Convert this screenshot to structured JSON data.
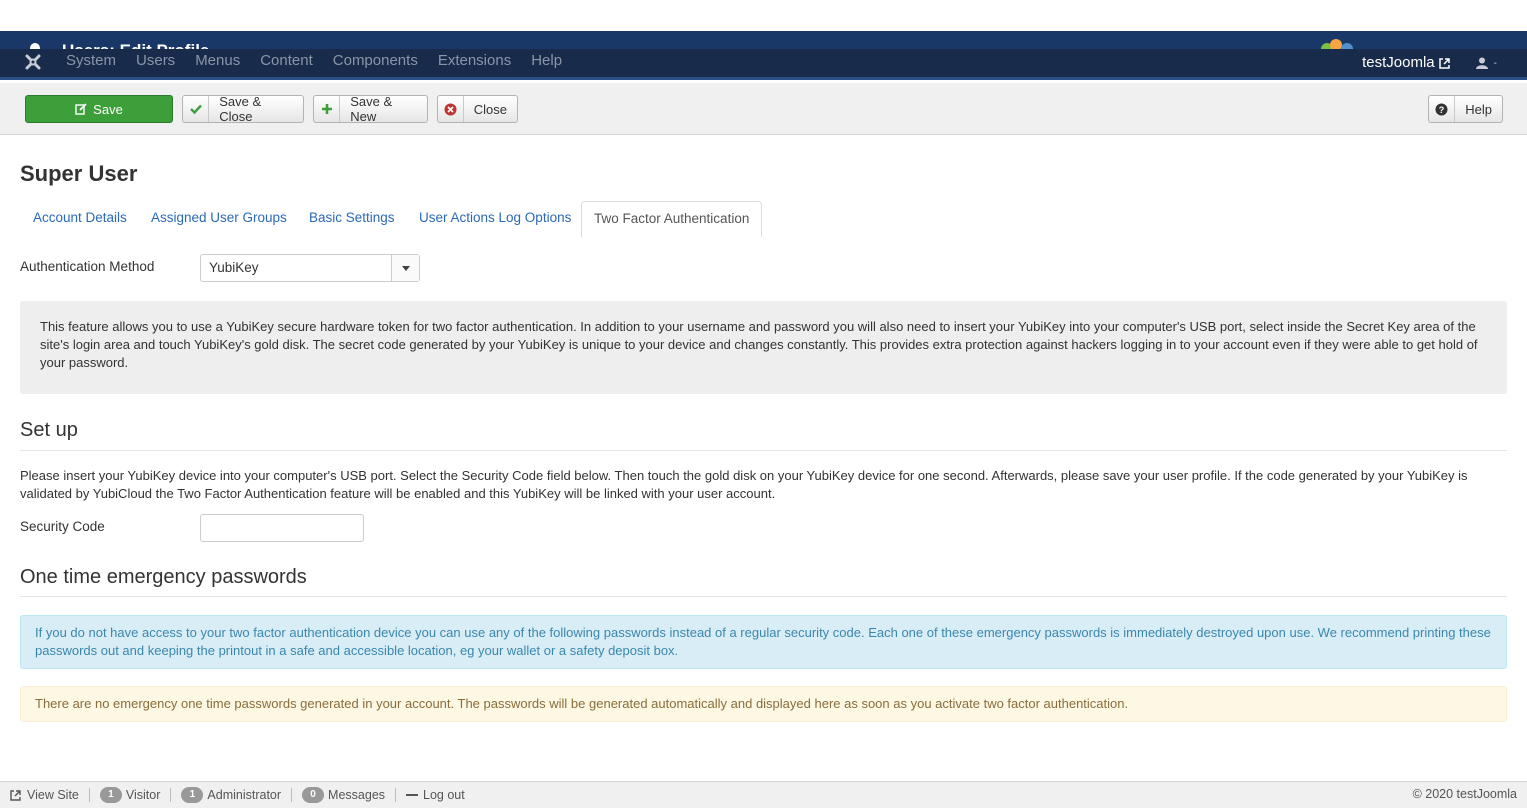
{
  "header": {
    "title_ghost": "Users: Edit Profile"
  },
  "navbar": {
    "menu": [
      "System",
      "Users",
      "Menus",
      "Content",
      "Components",
      "Extensions",
      "Help"
    ],
    "site_name": "testJoomla"
  },
  "toolbar": {
    "save": "Save",
    "save_close": "Save & Close",
    "save_new": "Save & New",
    "close": "Close",
    "help": "Help"
  },
  "page": {
    "title": "Super User",
    "tabs": [
      "Account Details",
      "Assigned User Groups",
      "Basic Settings",
      "User Actions Log Options",
      "Two Factor Authentication"
    ],
    "active_tab": "Two Factor Authentication"
  },
  "auth": {
    "method_label": "Authentication Method",
    "method_value": "YubiKey",
    "description": "This feature allows you to use a YubiKey secure hardware token for two factor authentication. In addition to your username and password you will also need to insert your YubiKey into your computer's USB port, select inside the Secret Key area of the site's login area and touch YubiKey's gold disk. The secret code generated by your YubiKey is unique to your device and changes constantly. This provides extra protection against hackers logging in to your account even if they were able to get hold of your password."
  },
  "setup": {
    "title": "Set up",
    "instructions": "Please insert your YubiKey device into your computer's USB port. Select the Security Code field below. Then touch the gold disk on your YubiKey device for one second. Afterwards, please save your user profile. If the code generated by your YubiKey is validated by YubiCloud the Two Factor Authentication feature will be enabled and this YubiKey will be linked with your user account.",
    "code_label": "Security Code",
    "code_value": ""
  },
  "emergency": {
    "title": "One time emergency passwords",
    "info": "If you do not have access to your two factor authentication device you can use any of the following passwords instead of a regular security code. Each one of these emergency passwords is immediately destroyed upon use. We recommend printing these passwords out and keeping the printout in a safe and accessible location, eg your wallet or a safety deposit box.",
    "warning": "There are no emergency one time passwords generated in your account. The passwords will be generated automatically and displayed here as soon as you activate two factor authentication."
  },
  "footer": {
    "view_site": "View Site",
    "visitor_count": "1",
    "visitor_label": "Visitor",
    "admin_count": "1",
    "admin_label": "Administrator",
    "messages_count": "0",
    "messages_label": "Messages",
    "logout": "Log out",
    "copyright": "© 2020 testJoomla"
  },
  "colors": {
    "header": "#1a3867",
    "navbar": "#182b4a",
    "save_button": "#3d9f3a",
    "link": "#2a69b8",
    "info_bg": "#d9edf7",
    "warning_bg": "#fcf8e3"
  }
}
